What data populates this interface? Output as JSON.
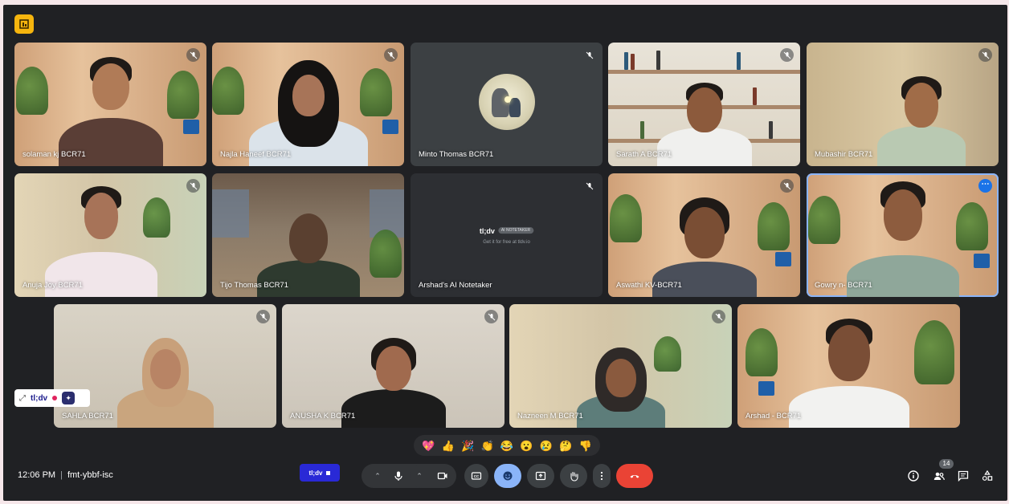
{
  "meeting": {
    "time": "12:06 PM",
    "code": "fmt-ybbf-isc",
    "participant_count": "14"
  },
  "participants": [
    {
      "name": "solaman kj BCR71"
    },
    {
      "name": "Najla Haneef BCR71"
    },
    {
      "name": "Minto Thomas BCR71"
    },
    {
      "name": "Sarath A BCR71"
    },
    {
      "name": "Mubashir BCR71"
    },
    {
      "name": "Anuja Joy BCR71"
    },
    {
      "name": "Tijo Thomas BCR71"
    },
    {
      "name": "Arshad's AI Notetaker"
    },
    {
      "name": "Aswathi KV-BCR71"
    },
    {
      "name": "Gowry n- BCR71"
    },
    {
      "name": "SAHLA BCR71"
    },
    {
      "name": "ANUSHA K BCR71"
    },
    {
      "name": "Nazneen M BCR71"
    },
    {
      "name": "Arshad - BCR71"
    }
  ],
  "notetaker_tile": {
    "brand": "tl;dv",
    "tag": "AI NOTETAKER",
    "subtitle": "Get it for free at tldv.io"
  },
  "recorder": {
    "brand": "tl;dv",
    "record_button_label": "tl;dv"
  },
  "reactions": [
    "💖",
    "👍",
    "🎉",
    "👏",
    "😂",
    "😮",
    "😢",
    "🤔",
    "👎"
  ],
  "icons": {
    "mic": "mic-icon",
    "camera": "camera-icon",
    "captions": "captions-icon",
    "emoji": "emoji-icon",
    "present": "present-icon",
    "hand": "raise-hand-icon",
    "more": "more-vert-icon",
    "end": "end-call-icon",
    "info": "info-icon",
    "people": "people-icon",
    "chat": "chat-icon",
    "activities": "activities-icon"
  },
  "colors": {
    "background": "#202124",
    "tile_dark": "#3c4043",
    "end_call": "#ea4335",
    "emoji_active": "#8ab4f8",
    "active_speaker_border": "#8ab4f8",
    "tldv_blue": "#2929d6",
    "logo_yellow": "#f6b50e"
  }
}
